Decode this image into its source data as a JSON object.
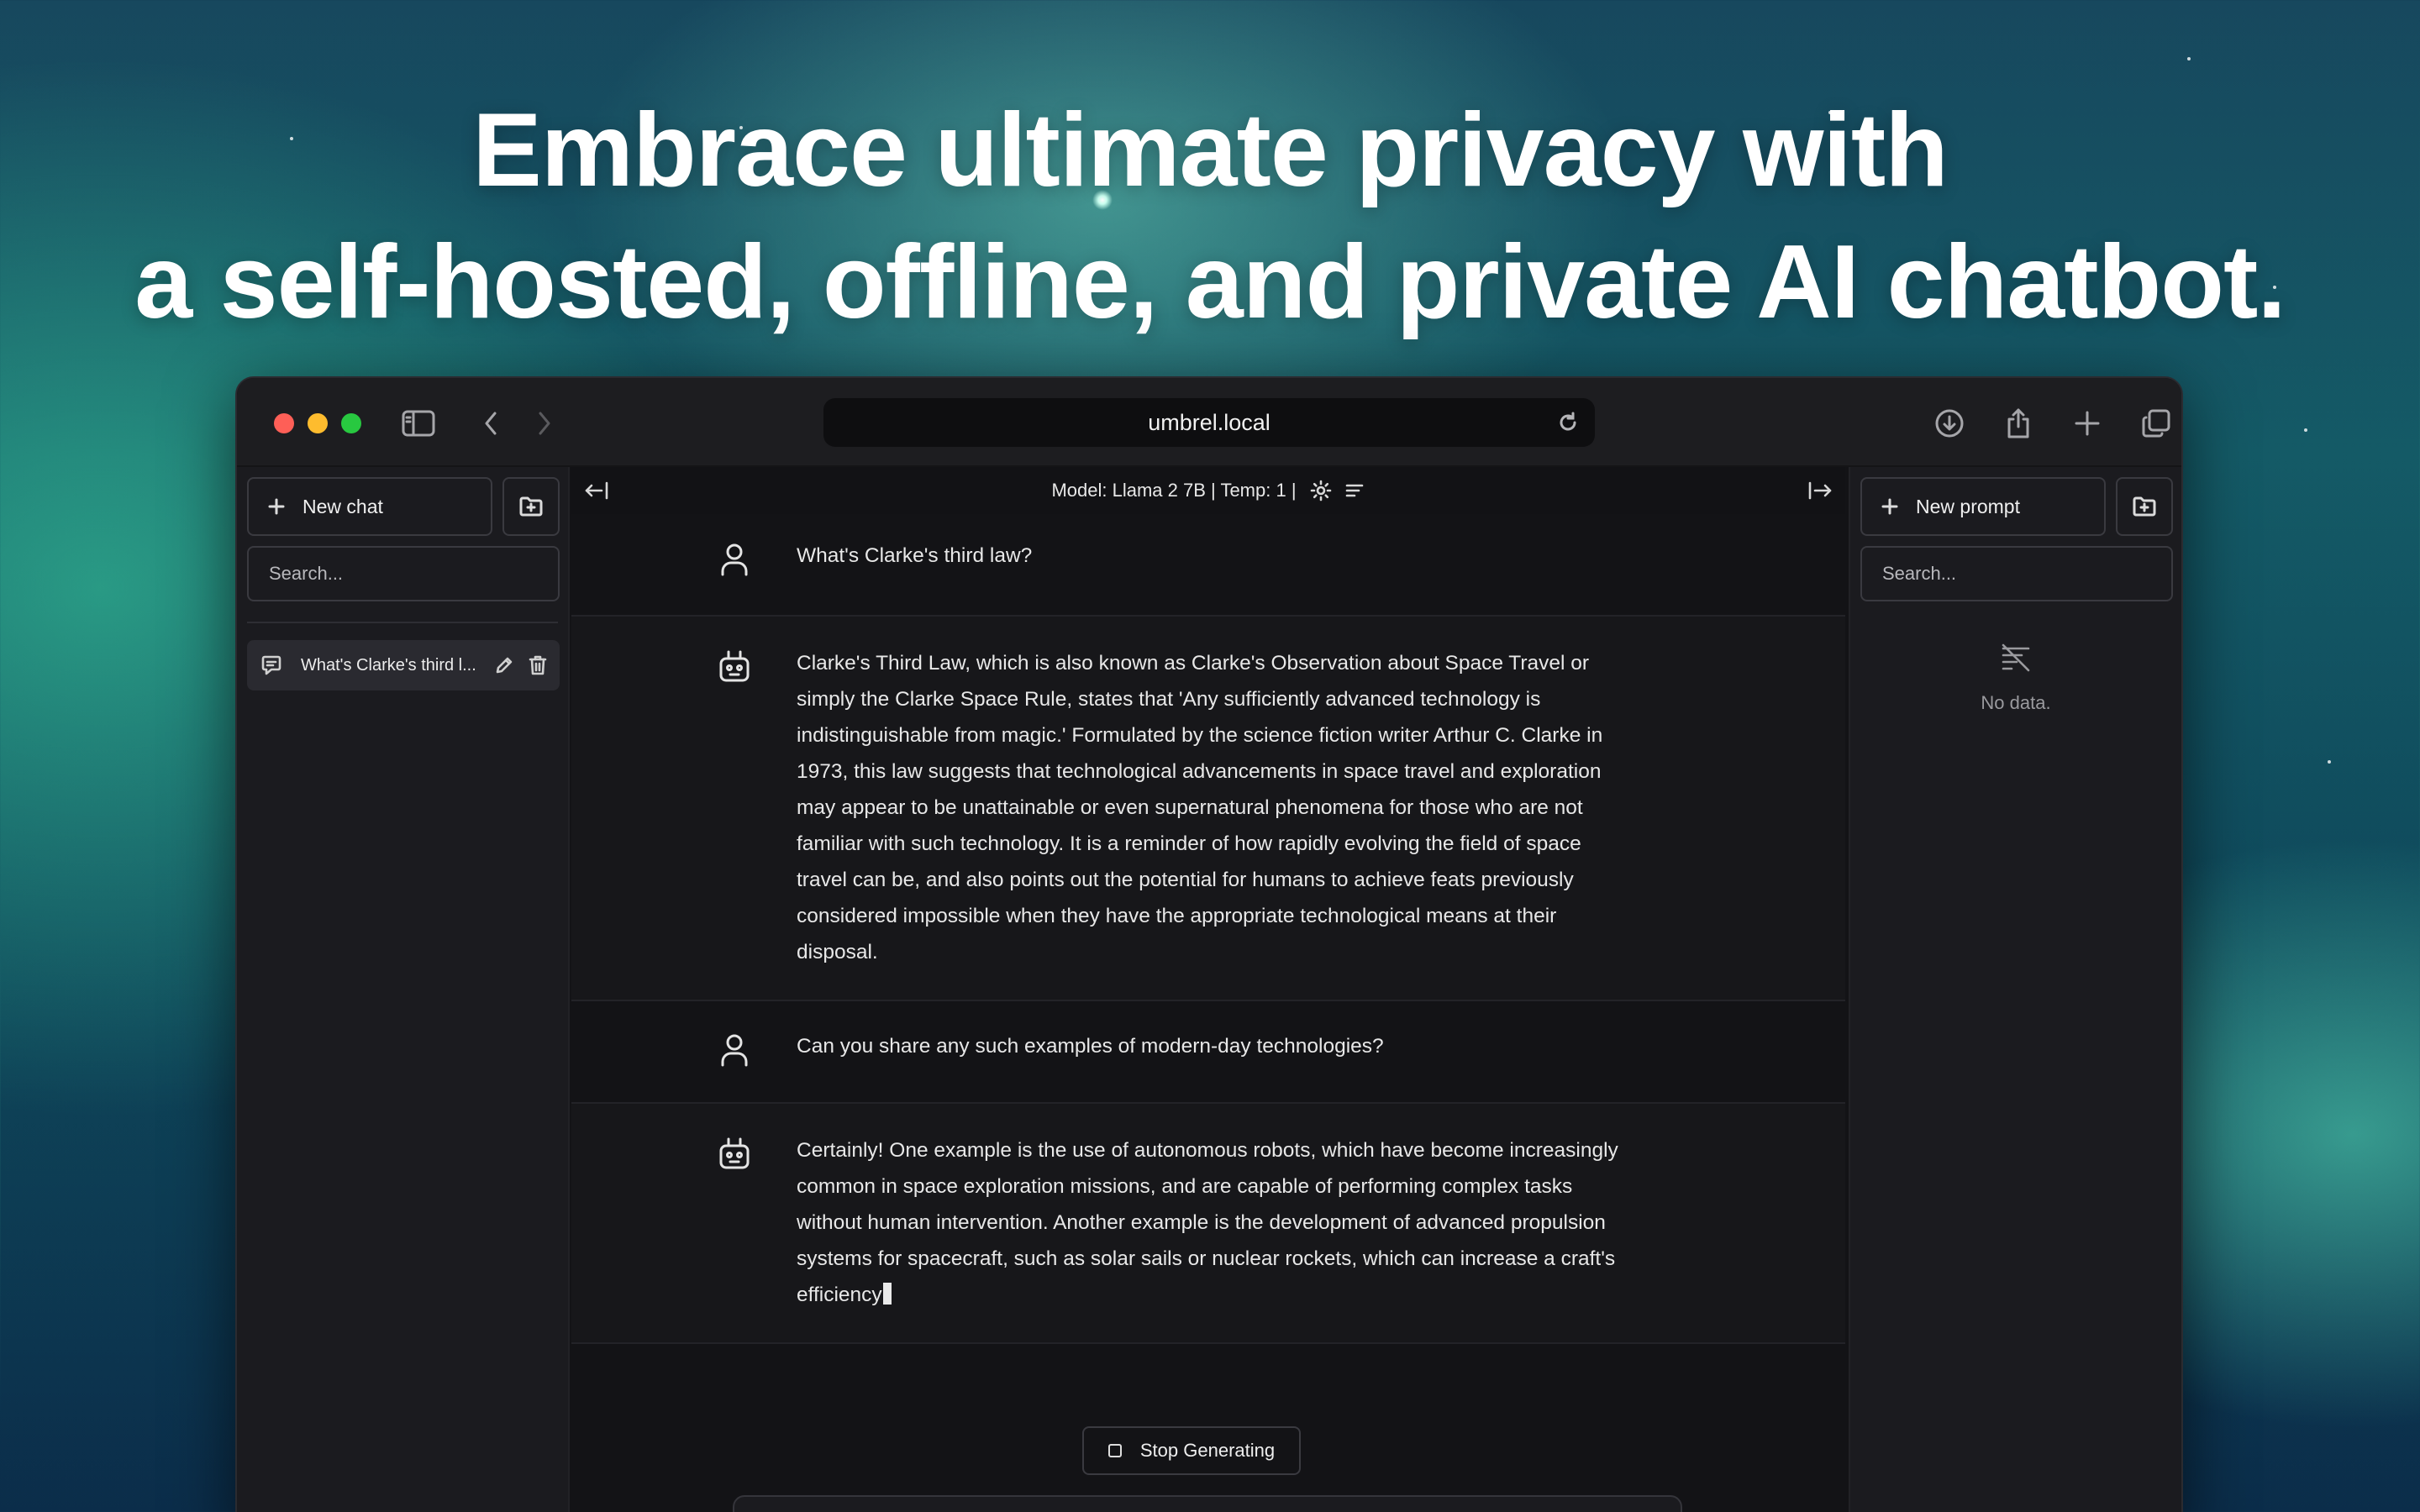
{
  "headline": {
    "line1": "Embrace ultimate privacy with",
    "line2": "a self-hosted, offline, and private AI chatbot."
  },
  "browser": {
    "url": "umbrel.local",
    "icons": [
      "sidebar-toggle-icon",
      "back-icon",
      "forward-icon",
      "reload-icon",
      "download-icon",
      "share-icon",
      "new-tab-icon",
      "tabs-overview-icon"
    ]
  },
  "sidebar_left": {
    "new_chat_label": "New chat",
    "search_placeholder": "Search...",
    "conversations": [
      {
        "title": "What's Clarke's third l..."
      }
    ]
  },
  "chat_header": {
    "model_text": "Model: Llama 2 7B | Temp: 1 |"
  },
  "messages": [
    {
      "role": "user",
      "text": "What's Clarke's third law?"
    },
    {
      "role": "assistant",
      "text": "Clarke's Third Law, which is also known as Clarke's Observation about Space Travel or simply the Clarke Space Rule, states that 'Any sufficiently advanced technology is indistinguishable from magic.' Formulated by the science fiction writer Arthur C. Clarke in 1973, this law suggests that technological advancements in space travel and exploration may appear to be unattainable or even supernatural phenomena for those who are not familiar with such technology. It is a reminder of how rapidly evolving the field of space travel can be, and also points out the potential for humans to achieve feats previously considered impossible when they have the appropriate technological means at their disposal."
    },
    {
      "role": "user",
      "text": "Can you share any such examples of modern-day technologies?"
    },
    {
      "role": "assistant",
      "text": "Certainly! One example is the use of autonomous robots, which have become increasingly common in space exploration missions, and are capable of performing complex tasks without human intervention. Another example is the development of advanced propulsion systems for spacecraft, such as solar sails or nuclear rockets, which can increase a craft's efficiency"
    }
  ],
  "stop_button_label": "Stop Generating",
  "sidebar_right": {
    "new_prompt_label": "New prompt",
    "search_placeholder": "Search...",
    "empty_text": "No data."
  }
}
